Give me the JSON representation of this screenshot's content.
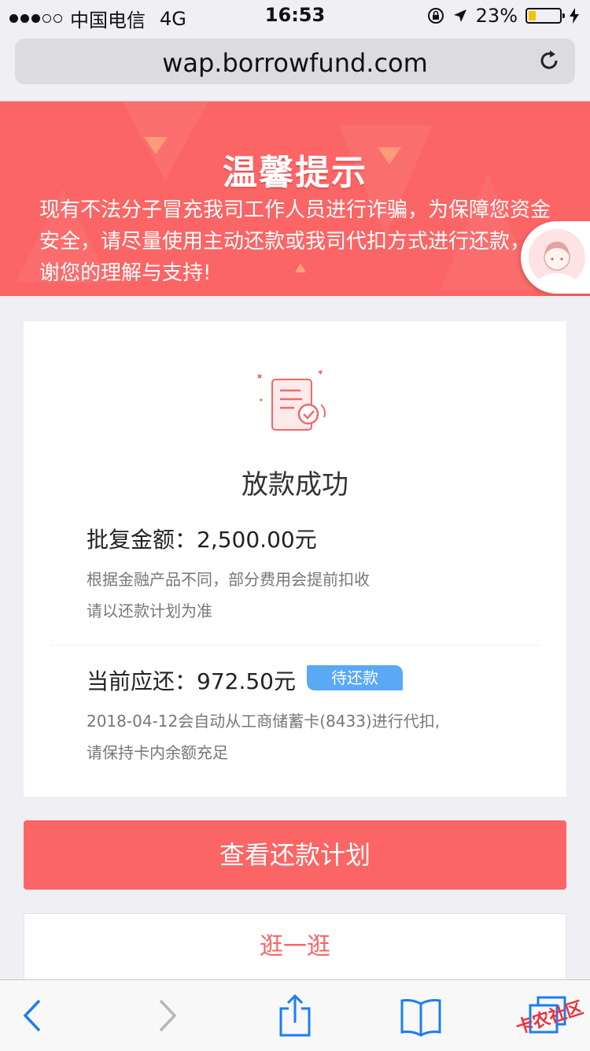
{
  "status_bar": {
    "carrier": "中国电信",
    "network": "4G",
    "time": "16:53",
    "battery_percent_label": "23%",
    "battery_level": 0.23
  },
  "browser": {
    "url": "wap.borrowfund.com"
  },
  "banner": {
    "title": "温馨提示",
    "text": "现有不法分子冒充我司工作人员进行诈骗，为保障您资金安全，请尽量使用主动还款或我司代扣方式进行还款，感谢您的理解与支持!"
  },
  "card": {
    "status_title": "放款成功",
    "approved_label": "批复金额：",
    "approved_amount": "2,500.00元",
    "approved_note_1": "根据金融产品不同，部分费用会提前扣收",
    "approved_note_2": "请以还款计划为准",
    "due_label": "当前应还：",
    "due_amount": "972.50元",
    "due_badge": "待还款",
    "due_note_1": "2018-04-12会自动从工商储蓄卡(8433)进行代扣,",
    "due_note_2": "请保持卡内余额充足"
  },
  "buttons": {
    "view_plan": "查看还款计划",
    "stroll": "逛一逛"
  },
  "watermark": "卡农社区",
  "colors": {
    "accent": "#fb6565",
    "badge": "#59a9f5",
    "ios_blue": "#1a7ef5"
  }
}
